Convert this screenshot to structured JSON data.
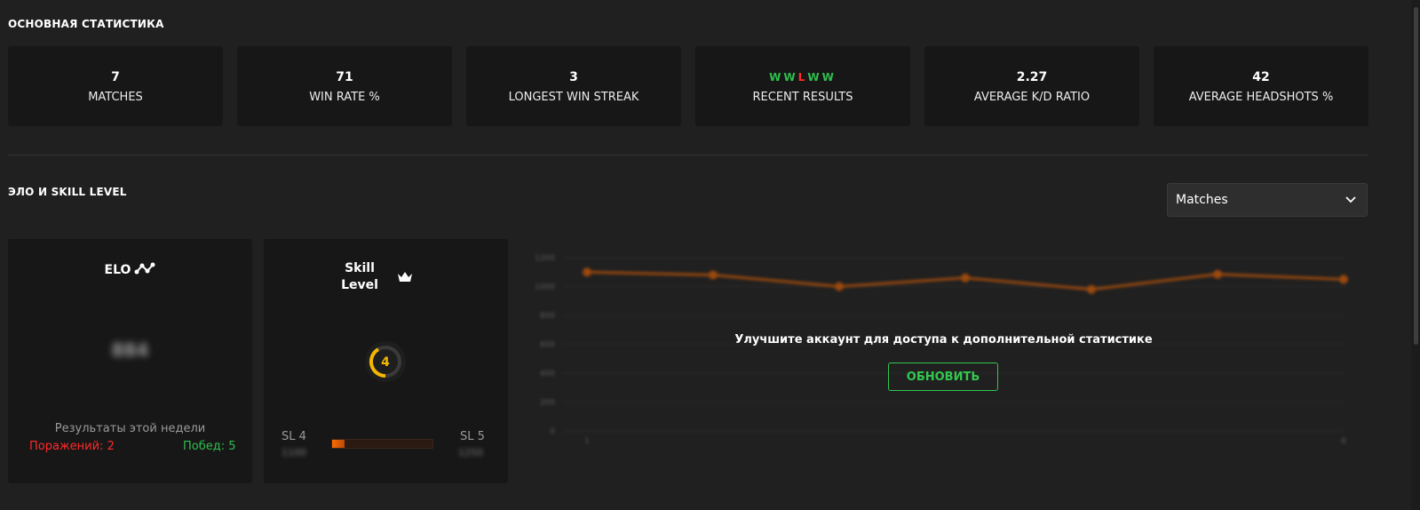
{
  "sections": {
    "main_title": "ОСНОВНАЯ СТАТИСТИКА",
    "elo_title": "ЭЛО И SKILL LEVEL"
  },
  "stats": [
    {
      "value": "7",
      "label": "MATCHES"
    },
    {
      "value": "71",
      "label": "WIN RATE %"
    },
    {
      "value": "3",
      "label": "LONGEST WIN STREAK"
    },
    {
      "value": "",
      "label": "RECENT RESULTS"
    },
    {
      "value": "2.27",
      "label": "AVERAGE K/D RATIO"
    },
    {
      "value": "42",
      "label": "AVERAGE HEADSHOTS %"
    }
  ],
  "recent_results": [
    "W",
    "W",
    "L",
    "W",
    "W"
  ],
  "dropdown": {
    "selected": "Matches"
  },
  "elo": {
    "title": "ELO",
    "value": "884",
    "week_title": "Результаты этой недели",
    "losses": "Поражений: 2",
    "wins": "Побед: 5"
  },
  "skill": {
    "title_line1": "Skill",
    "title_line2": "Level",
    "level": "4",
    "sl_left": "SL 4",
    "sl_right": "SL 5",
    "sl_left_value": "1100",
    "sl_right_value": "1250",
    "progress_fraction": 0.12
  },
  "upgrade": {
    "text": "Улучшите аккаунт для доступа к дополнительной статистике",
    "button": "ОБНОВИТЬ"
  },
  "chart_data": {
    "type": "line",
    "x": [
      1,
      2,
      3,
      4,
      5,
      6,
      7
    ],
    "values": [
      1100,
      1080,
      1000,
      1060,
      980,
      1085,
      1050
    ],
    "ylim": [
      0,
      1200
    ],
    "yticks": [
      "1200",
      "1000",
      "800",
      "600",
      "400",
      "200",
      "0"
    ],
    "xticks": [
      "1",
      "8"
    ],
    "color": "#ff6a00"
  },
  "colors": {
    "win": "#2fbf4e",
    "loss": "#ff2a2a",
    "accent": "#ff6a00",
    "level": "#f5b800",
    "button": "#32c850"
  }
}
